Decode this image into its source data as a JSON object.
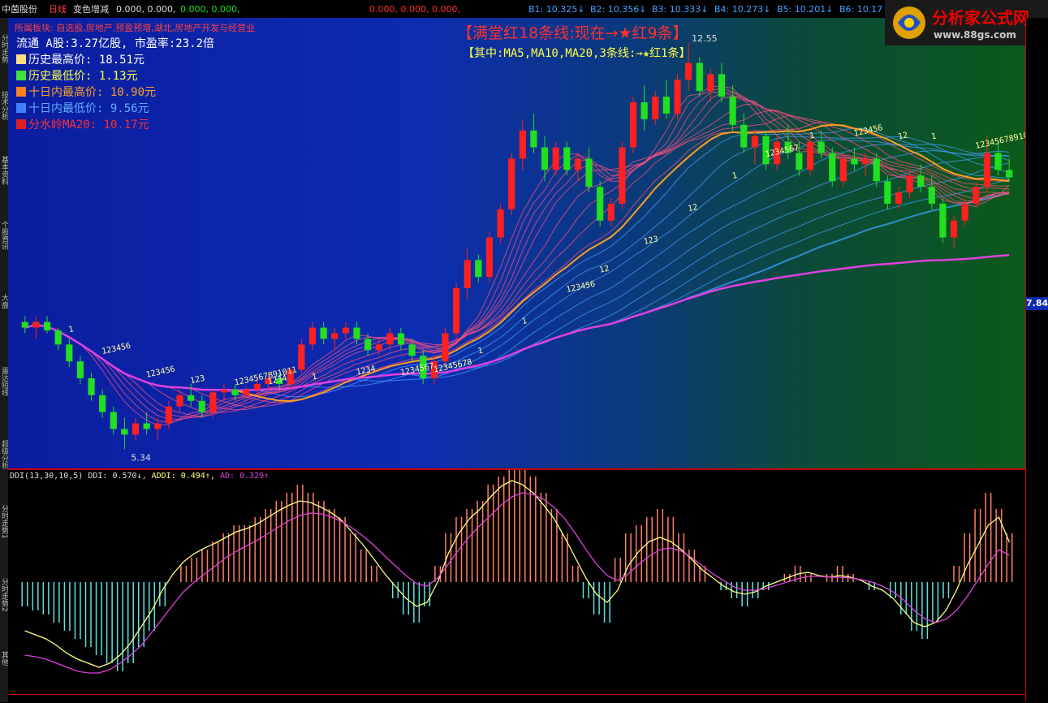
{
  "top_bar": {
    "stock_name": "中茵股份",
    "period": "日线",
    "indicator_name": "变色增减",
    "values_prefix": "0.000, 0.000,",
    "values_green": "0.000, 0.000,",
    "values_red": "0.000, 0.000, 0.000,",
    "b1": "B1: 10.325↓",
    "b2": "B2: 10.356↓",
    "b3": "B3: 10.333↓",
    "b4": "B4: 10.273↓",
    "b5": "B5: 10.201↓",
    "b6": "B6: 10.17"
  },
  "left_strip": [
    "分时走势",
    "技术分析",
    "基本资料",
    "个股資讯",
    "大盘",
    "雷达短线",
    "超级分析",
    "分时走势1",
    "分时走势2",
    "其他"
  ],
  "info": {
    "sector": "所属板块: 自选股,房地产,预盈预增,湖北,房地产开发与经营业",
    "float_line": "流通 A股:3.27亿股,  市盈率:23.2倍",
    "hist_high": "历史最高价:   18.51元",
    "hist_low": "历史最低价:   1.13元",
    "ten_high": "十日内最高价: 10.90元",
    "ten_low": "十日内最低价: 9.56元",
    "ma20": "分水岭MA20:   10.17元"
  },
  "headline": "【满堂红18条线:现在→★红9条】",
  "subline": "【其中:MA5,MA10,MA20,3条线:→★红1条】",
  "logo": {
    "title": "分析家公式网",
    "url": "www.88gs.com"
  },
  "price_tag": "7.84",
  "peak_label": "12.55",
  "low_label": "5.34",
  "colors": {
    "up": "#ff2020",
    "down": "#20e020",
    "ma_orange": "#ffa020",
    "ma_magenta": "#e040e0",
    "fan_blue": "#40a0ff",
    "ddi_up": "#ff8060",
    "ddi_down": "#60e0e0",
    "addi": "#ffff80",
    "ad": "#e040e0"
  },
  "count_labels": [
    "1",
    "123456",
    "123456",
    "123",
    "1234567891011",
    "1234",
    "1",
    "1234",
    "1234567",
    "12345678",
    "1",
    "1",
    "123456",
    "12",
    "123",
    "12",
    "1",
    "1234567",
    "1",
    "123456",
    "12",
    "1",
    "12345678910"
  ],
  "indicator": {
    "name": "DDI(13,30,10,5)",
    "ddi": "DDI: 0.570↓,",
    "addi": "ADDI: 0.494↑,",
    "ad": "AD: 0.329↑"
  },
  "chart_data": {
    "type": "candlestick",
    "ylim": [
      5.0,
      13.0
    ],
    "candles": [
      [
        7.6,
        7.7,
        7.4,
        7.5
      ],
      [
        7.5,
        7.7,
        7.3,
        7.6
      ],
      [
        7.6,
        7.7,
        7.4,
        7.45
      ],
      [
        7.45,
        7.5,
        7.1,
        7.2
      ],
      [
        7.2,
        7.3,
        6.8,
        6.9
      ],
      [
        6.9,
        7.0,
        6.5,
        6.6
      ],
      [
        6.6,
        6.7,
        6.2,
        6.3
      ],
      [
        6.3,
        6.4,
        5.9,
        6.0
      ],
      [
        6.0,
        6.1,
        5.6,
        5.7
      ],
      [
        5.7,
        5.9,
        5.34,
        5.6
      ],
      [
        5.6,
        5.9,
        5.5,
        5.8
      ],
      [
        5.8,
        6.0,
        5.6,
        5.7
      ],
      [
        5.7,
        5.9,
        5.5,
        5.8
      ],
      [
        5.8,
        6.2,
        5.7,
        6.1
      ],
      [
        6.1,
        6.4,
        6.0,
        6.3
      ],
      [
        6.3,
        6.5,
        6.1,
        6.2
      ],
      [
        6.2,
        6.3,
        5.9,
        6.0
      ],
      [
        6.0,
        6.4,
        5.9,
        6.35
      ],
      [
        6.35,
        6.5,
        6.2,
        6.4
      ],
      [
        6.4,
        6.5,
        6.2,
        6.3
      ],
      [
        6.3,
        6.45,
        6.2,
        6.4
      ],
      [
        6.4,
        6.6,
        6.3,
        6.5
      ],
      [
        6.5,
        6.7,
        6.4,
        6.6
      ],
      [
        6.6,
        6.7,
        6.4,
        6.5
      ],
      [
        6.5,
        6.8,
        6.4,
        6.75
      ],
      [
        6.75,
        7.3,
        6.7,
        7.2
      ],
      [
        7.2,
        7.6,
        7.1,
        7.5
      ],
      [
        7.5,
        7.6,
        7.2,
        7.3
      ],
      [
        7.3,
        7.5,
        7.1,
        7.4
      ],
      [
        7.4,
        7.6,
        7.3,
        7.5
      ],
      [
        7.5,
        7.6,
        7.2,
        7.3
      ],
      [
        7.3,
        7.4,
        7.0,
        7.1
      ],
      [
        7.1,
        7.3,
        7.0,
        7.2
      ],
      [
        7.2,
        7.5,
        7.1,
        7.4
      ],
      [
        7.4,
        7.5,
        7.1,
        7.2
      ],
      [
        7.2,
        7.3,
        6.9,
        7.0
      ],
      [
        7.0,
        7.1,
        6.5,
        6.6
      ],
      [
        6.6,
        7.0,
        6.5,
        6.9
      ],
      [
        6.9,
        7.5,
        6.8,
        7.4
      ],
      [
        7.4,
        8.3,
        7.3,
        8.2
      ],
      [
        8.2,
        8.9,
        8.0,
        8.7
      ],
      [
        8.7,
        8.8,
        8.3,
        8.4
      ],
      [
        8.4,
        9.2,
        8.3,
        9.1
      ],
      [
        9.1,
        9.7,
        9.0,
        9.6
      ],
      [
        9.6,
        10.6,
        9.5,
        10.5
      ],
      [
        10.5,
        11.2,
        10.3,
        11.0
      ],
      [
        11.0,
        11.3,
        10.6,
        10.7
      ],
      [
        10.7,
        10.9,
        10.1,
        10.3
      ],
      [
        10.3,
        10.8,
        10.2,
        10.7
      ],
      [
        10.7,
        10.8,
        10.2,
        10.3
      ],
      [
        10.3,
        10.6,
        10.1,
        10.5
      ],
      [
        10.5,
        10.7,
        9.9,
        10.0
      ],
      [
        10.0,
        10.1,
        9.3,
        9.4
      ],
      [
        9.4,
        9.8,
        9.3,
        9.7
      ],
      [
        9.7,
        10.8,
        9.6,
        10.7
      ],
      [
        10.7,
        11.6,
        10.6,
        11.5
      ],
      [
        11.5,
        11.8,
        11.0,
        11.2
      ],
      [
        11.2,
        11.7,
        11.1,
        11.6
      ],
      [
        11.6,
        11.9,
        11.2,
        11.3
      ],
      [
        11.3,
        12.0,
        11.2,
        11.9
      ],
      [
        11.9,
        12.55,
        11.7,
        12.2
      ],
      [
        12.2,
        12.3,
        11.6,
        11.7
      ],
      [
        11.7,
        12.1,
        11.5,
        12.0
      ],
      [
        12.0,
        12.2,
        11.5,
        11.6
      ],
      [
        11.6,
        11.8,
        11.0,
        11.1
      ],
      [
        11.1,
        11.3,
        10.6,
        10.7
      ],
      [
        10.7,
        11.0,
        10.4,
        10.9
      ],
      [
        10.9,
        11.0,
        10.3,
        10.4
      ],
      [
        10.4,
        10.9,
        10.3,
        10.8
      ],
      [
        10.8,
        11.1,
        10.5,
        10.6
      ],
      [
        10.6,
        10.8,
        10.2,
        10.3
      ],
      [
        10.3,
        10.9,
        10.2,
        10.8
      ],
      [
        10.8,
        11.0,
        10.5,
        10.6
      ],
      [
        10.6,
        10.7,
        10.0,
        10.1
      ],
      [
        10.1,
        10.6,
        10.0,
        10.5
      ],
      [
        10.5,
        10.7,
        10.3,
        10.4
      ],
      [
        10.4,
        10.6,
        10.2,
        10.5
      ],
      [
        10.5,
        10.6,
        10.0,
        10.1
      ],
      [
        10.1,
        10.2,
        9.6,
        9.7
      ],
      [
        9.7,
        10.0,
        9.6,
        9.9
      ],
      [
        9.9,
        10.3,
        9.8,
        10.2
      ],
      [
        10.2,
        10.4,
        9.9,
        10.0
      ],
      [
        10.0,
        10.2,
        9.6,
        9.7
      ],
      [
        9.7,
        9.8,
        9.0,
        9.1
      ],
      [
        9.1,
        9.5,
        8.9,
        9.4
      ],
      [
        9.4,
        9.8,
        9.3,
        9.7
      ],
      [
        9.7,
        10.1,
        9.6,
        10.0
      ],
      [
        10.0,
        10.9,
        9.9,
        10.6
      ],
      [
        10.6,
        10.8,
        10.2,
        10.3
      ],
      [
        10.3,
        10.5,
        10.1,
        10.17
      ]
    ],
    "ddi": [
      -0.3,
      -0.35,
      -0.4,
      -0.5,
      -0.6,
      -0.7,
      -0.8,
      -0.9,
      -1.0,
      -1.1,
      -1.0,
      -0.8,
      -0.6,
      -0.3,
      0.0,
      0.2,
      0.3,
      0.4,
      0.5,
      0.6,
      0.7,
      0.7,
      0.8,
      0.9,
      1.0,
      1.1,
      1.2,
      1.1,
      1.0,
      0.9,
      0.8,
      0.6,
      0.4,
      0.2,
      0.0,
      -0.2,
      -0.4,
      -0.5,
      -0.3,
      0.2,
      0.6,
      0.8,
      0.9,
      1.0,
      1.2,
      1.3,
      1.4,
      1.5,
      1.3,
      1.1,
      0.9,
      0.6,
      0.2,
      -0.2,
      -0.4,
      -0.5,
      0.3,
      0.6,
      0.7,
      0.8,
      0.9,
      0.8,
      0.6,
      0.4,
      0.2,
      0.0,
      -0.1,
      -0.2,
      -0.3,
      -0.2,
      -0.1,
      0.0,
      0.1,
      0.2,
      0.1,
      0.0,
      0.1,
      0.2,
      0.1,
      0.0,
      -0.1,
      0.0,
      -0.2,
      -0.4,
      -0.6,
      -0.7,
      -0.5,
      -0.2,
      0.2,
      0.6,
      0.9,
      1.1,
      0.9,
      0.6
    ],
    "addi": [
      -0.6,
      -0.65,
      -0.7,
      -0.78,
      -0.88,
      -0.95,
      -1.0,
      -1.05,
      -1.0,
      -0.9,
      -0.75,
      -0.55,
      -0.35,
      -0.1,
      0.1,
      0.25,
      0.35,
      0.42,
      0.48,
      0.55,
      0.62,
      0.66,
      0.72,
      0.8,
      0.88,
      0.95,
      1.0,
      0.98,
      0.92,
      0.85,
      0.75,
      0.6,
      0.45,
      0.28,
      0.1,
      -0.05,
      -0.2,
      -0.3,
      -0.25,
      0.0,
      0.35,
      0.6,
      0.78,
      0.9,
      1.05,
      1.18,
      1.25,
      1.2,
      1.1,
      0.95,
      0.78,
      0.55,
      0.3,
      0.05,
      -0.15,
      -0.25,
      -0.1,
      0.2,
      0.38,
      0.5,
      0.55,
      0.5,
      0.4,
      0.28,
      0.15,
      0.05,
      -0.05,
      -0.12,
      -0.15,
      -0.12,
      -0.05,
      0.0,
      0.05,
      0.1,
      0.12,
      0.08,
      0.06,
      0.08,
      0.06,
      0.02,
      -0.05,
      -0.1,
      -0.2,
      -0.35,
      -0.5,
      -0.55,
      -0.5,
      -0.35,
      -0.1,
      0.2,
      0.45,
      0.7,
      0.8,
      0.49
    ],
    "ad": [
      -0.9,
      -0.92,
      -0.95,
      -1.0,
      -1.05,
      -1.1,
      -1.12,
      -1.12,
      -1.08,
      -1.0,
      -0.9,
      -0.78,
      -0.62,
      -0.45,
      -0.28,
      -0.12,
      0.0,
      0.1,
      0.2,
      0.3,
      0.38,
      0.45,
      0.52,
      0.6,
      0.68,
      0.76,
      0.82,
      0.85,
      0.84,
      0.8,
      0.74,
      0.66,
      0.56,
      0.45,
      0.32,
      0.2,
      0.08,
      -0.02,
      -0.05,
      0.05,
      0.22,
      0.4,
      0.56,
      0.7,
      0.82,
      0.95,
      1.05,
      1.1,
      1.08,
      1.02,
      0.92,
      0.78,
      0.6,
      0.4,
      0.22,
      0.08,
      0.02,
      0.1,
      0.22,
      0.32,
      0.4,
      0.42,
      0.38,
      0.3,
      0.2,
      0.1,
      0.02,
      -0.06,
      -0.1,
      -0.1,
      -0.08,
      -0.04,
      0.0,
      0.04,
      0.07,
      0.07,
      0.06,
      0.06,
      0.05,
      0.03,
      0.0,
      -0.05,
      -0.12,
      -0.22,
      -0.35,
      -0.45,
      -0.5,
      -0.46,
      -0.35,
      -0.18,
      0.02,
      0.22,
      0.4,
      0.33
    ]
  }
}
